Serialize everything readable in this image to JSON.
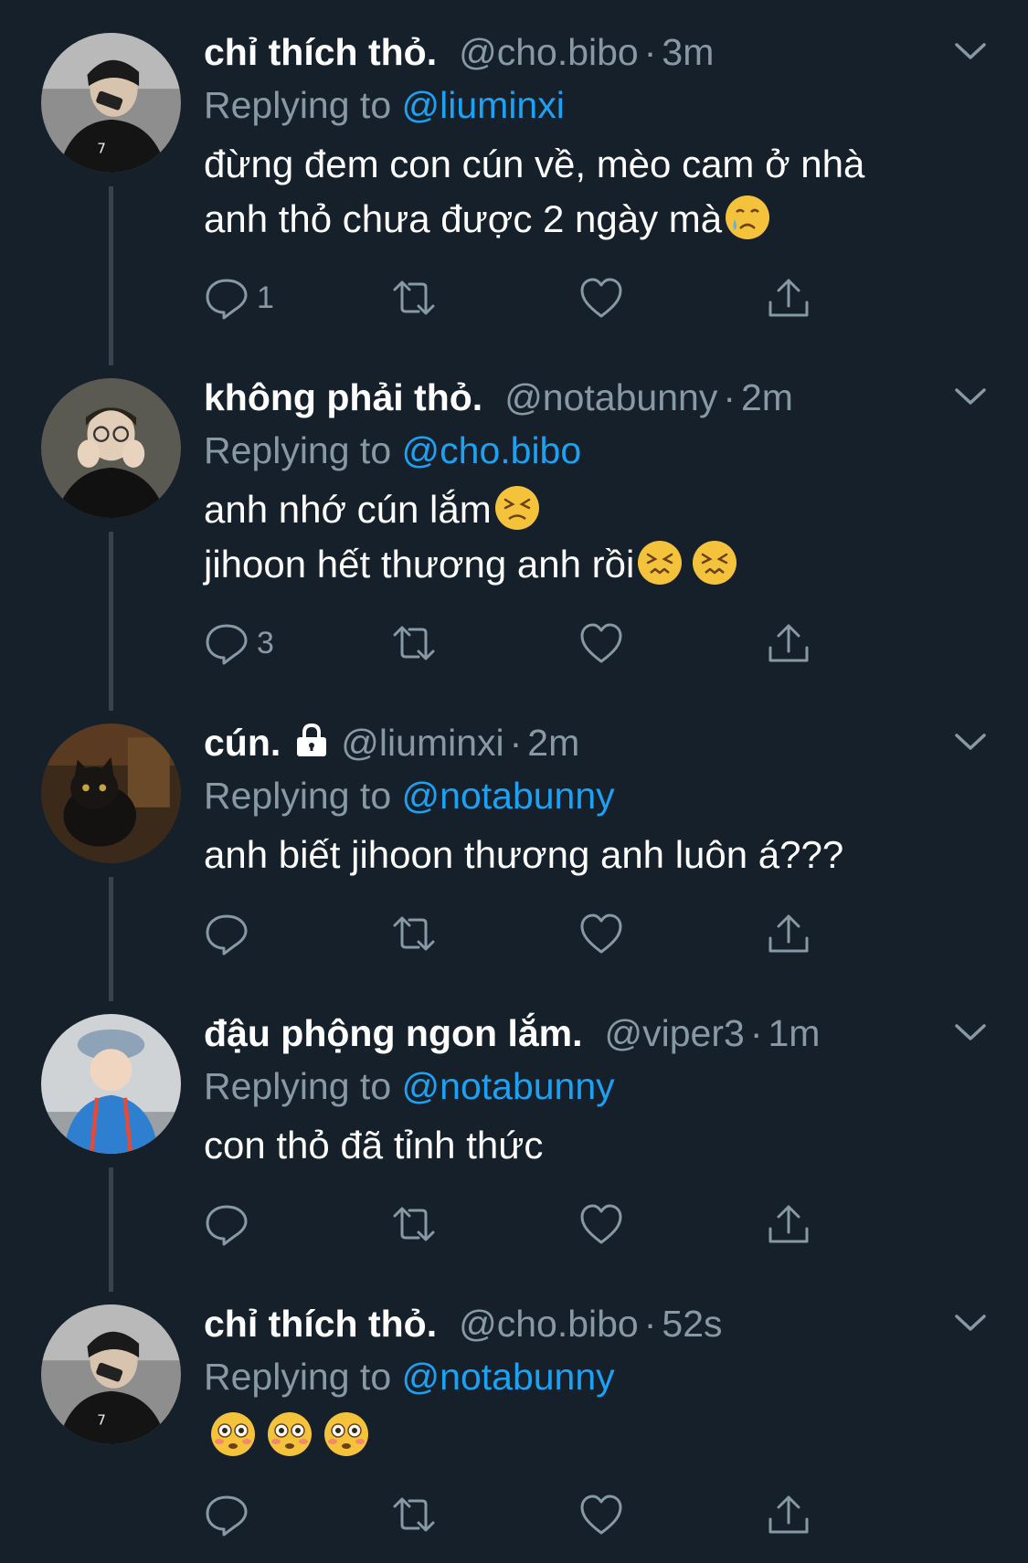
{
  "tweets": [
    {
      "name": "chỉ thích thỏ.",
      "handle": "@cho.bibo",
      "time": "3m",
      "replying_prefix": "Replying to",
      "replying_to": "@liuminxi",
      "body_lines": [
        "đừng đem con cún về, mèo cam ở nhà",
        "anh thỏ chưa được 2 ngày mà"
      ],
      "emojis": [
        "crying-face"
      ],
      "reply_count": "1",
      "locked": false,
      "avatar": "avatar-boy-phone"
    },
    {
      "name": "không phải thỏ.",
      "handle": "@notabunny",
      "time": "2m",
      "replying_prefix": "Replying to",
      "replying_to": "@cho.bibo",
      "body_lines": [
        "anh nhớ cún lắm",
        "jihoon hết thương anh rồi"
      ],
      "emojis": [
        "persevering-face",
        "confounded-face",
        "confounded-face"
      ],
      "reply_count": "3",
      "locked": false,
      "avatar": "avatar-boy-hands"
    },
    {
      "name": "cún.",
      "handle": "@liuminxi",
      "time": "2m",
      "replying_prefix": "Replying to",
      "replying_to": "@notabunny",
      "body_lines": [
        "anh biết jihoon thương anh luôn á???"
      ],
      "emojis": [],
      "reply_count": "",
      "locked": true,
      "avatar": "avatar-black-cat"
    },
    {
      "name": "đậu phộng ngon lắm.",
      "handle": "@viper3",
      "time": "1m",
      "replying_prefix": "Replying to",
      "replying_to": "@notabunny",
      "body_lines": [
        "con thỏ đã tỉnh thức"
      ],
      "emojis": [],
      "reply_count": "",
      "locked": false,
      "avatar": "avatar-child-hat"
    },
    {
      "name": "chỉ thích thỏ.",
      "handle": "@cho.bibo",
      "time": "52s",
      "replying_prefix": "Replying to",
      "replying_to": "@notabunny",
      "body_lines": [
        ""
      ],
      "emojis": [
        "flushed-face",
        "flushed-face",
        "flushed-face"
      ],
      "reply_count": "",
      "locked": false,
      "avatar": "avatar-boy-phone"
    }
  ],
  "colors": {
    "background": "#15202b",
    "secondary_text": "#8899a6",
    "link": "#1da1f2",
    "thread_line": "#38444d"
  }
}
